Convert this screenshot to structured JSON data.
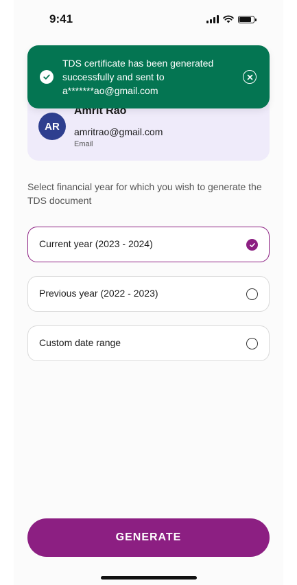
{
  "status_bar": {
    "time": "9:41"
  },
  "toast": {
    "message": "TDS certificate has been generated successfully and sent to a*******ao@gmail.com",
    "color": "#047552"
  },
  "profile": {
    "initials": "AR",
    "name": "Amrit Rao",
    "email": "amritrao@gmail.com",
    "email_label": "Email"
  },
  "instruction": "Select financial year for which you wish to generate the TDS document",
  "options": [
    {
      "label": "Current year (2023 - 2024)",
      "selected": true
    },
    {
      "label": "Previous year (2022 - 2023)",
      "selected": false
    },
    {
      "label": "Custom date range",
      "selected": false
    }
  ],
  "generate_label": "GENERATE",
  "accent_color": "#8c1f82",
  "icons": [
    "signal-icon",
    "wifi-icon",
    "battery-icon",
    "check-circle-icon",
    "close-circle-icon",
    "radio-checked-icon",
    "radio-unchecked-icon"
  ]
}
